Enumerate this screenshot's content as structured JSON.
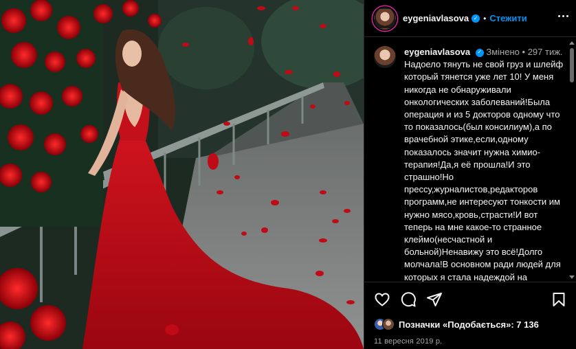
{
  "post": {
    "username": "eygeniavlasova",
    "follow_label": "Стежити",
    "separator": "•",
    "caption": {
      "username": "eygeniavlasova",
      "edited_label": "Змінено",
      "separator": "•",
      "age": "297 тиж.",
      "text": "Надоело тянуть не свой груз и шлейф который тянется уже лет 10! У меня никогда не обнаруживали онкологических заболеваний!Была операция и из 5 докторов одному что то показалось(был консилиум),а по врачебной этике,если,одному показалось значит нужна химио-терапия!Да,я её прошла!И это страшно!Но прессу,журналистов,редакторов программ,не интересуют тонкости им нужно мясо,кровь,страсти!И вот теперь на мне какое-то странное клеймо(несчастной и больной)Ненавижу это всё!Долго молчала!В основном ради людей для которых я стала надеждой на выздоровление!Но весь этот"
    },
    "likes_text": "Позначки «Подобається»: 7 136",
    "date": "11 вересня 2019 р."
  },
  "icons": {
    "verified": "verified-badge-icon",
    "more": "more-options-icon",
    "like": "heart-icon",
    "comment": "comment-icon",
    "share": "send-icon",
    "save": "bookmark-icon"
  },
  "colors": {
    "background": "#000000",
    "link": "#0095f6",
    "muted": "#a8a8a8",
    "dress": "#c8101a"
  }
}
